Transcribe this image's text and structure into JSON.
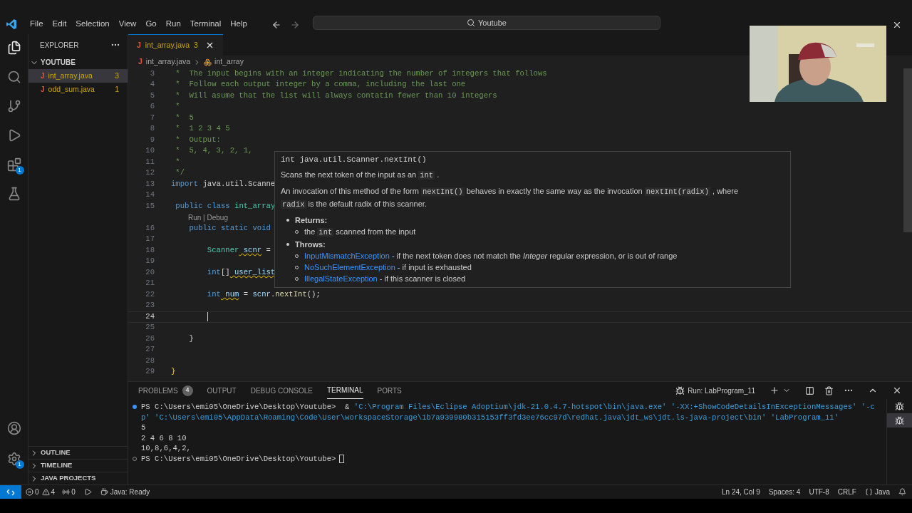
{
  "menu": [
    "File",
    "Edit",
    "Selection",
    "View",
    "Go",
    "Run",
    "Terminal",
    "Help"
  ],
  "command_center": {
    "value": "Youtube"
  },
  "activity_bar": [
    {
      "kind": "files",
      "selected": true
    },
    {
      "kind": "search",
      "selected": false
    },
    {
      "kind": "source-control",
      "selected": false
    },
    {
      "kind": "run",
      "selected": false
    },
    {
      "kind": "extensions",
      "selected": false,
      "badge": "1"
    },
    {
      "kind": "testing",
      "selected": false
    }
  ],
  "activity_bottom": [
    {
      "kind": "account"
    },
    {
      "kind": "settings",
      "badge": "1"
    }
  ],
  "sidebar": {
    "title": "EXPLORER",
    "folder": "YOUTUBE",
    "expanded": true,
    "files": [
      {
        "icon": "J",
        "name": "int_array.java",
        "count": "3",
        "selected": true
      },
      {
        "icon": "J",
        "name": "odd_sum.java",
        "count": "1",
        "selected": false
      }
    ],
    "sections": [
      {
        "label": "OUTLINE",
        "expanded": false
      },
      {
        "label": "TIMELINE",
        "expanded": false
      },
      {
        "label": "JAVA PROJECTS",
        "expanded": false
      }
    ]
  },
  "tabs": [
    {
      "icon": "J",
      "label": "int_array.java",
      "count": "3",
      "selected": true
    }
  ],
  "breadcrumb": {
    "icon": "J",
    "file": "int_array.java",
    "symbol": "int_array"
  },
  "lines": [
    {
      "number": "3",
      "kind": "code",
      "current": false,
      "segments": [
        {
          "text": " *  The input begins with an integer indicating the number of integers that follows",
          "kind": "comment"
        }
      ]
    },
    {
      "number": "4",
      "kind": "code",
      "current": false,
      "segments": [
        {
          "text": " *  Follow each output integer by a comma, including the last one",
          "kind": "comment"
        }
      ]
    },
    {
      "number": "5",
      "kind": "code",
      "current": false,
      "segments": [
        {
          "text": " *  Will asume that the list will always contatin fewer than 10 integers",
          "kind": "comment"
        }
      ]
    },
    {
      "number": "6",
      "kind": "code",
      "current": false,
      "segments": [
        {
          "text": " *",
          "kind": "comment"
        }
      ]
    },
    {
      "number": "7",
      "kind": "code",
      "current": false,
      "segments": [
        {
          "text": " *  5",
          "kind": "comment"
        }
      ]
    },
    {
      "number": "8",
      "kind": "code",
      "current": false,
      "segments": [
        {
          "text": " *  1 2 3 4 5",
          "kind": "comment"
        }
      ]
    },
    {
      "number": "9",
      "kind": "code",
      "current": false,
      "segments": [
        {
          "text": " *  Output:",
          "kind": "comment"
        }
      ]
    },
    {
      "number": "10",
      "kind": "code",
      "current": false,
      "segments": [
        {
          "text": " *  5, 4, 3, 2, 1,",
          "kind": "comment"
        }
      ]
    },
    {
      "number": "11",
      "kind": "code",
      "current": false,
      "segments": [
        {
          "text": " *",
          "kind": "comment"
        }
      ]
    },
    {
      "number": "12",
      "kind": "code",
      "current": false,
      "segments": [
        {
          "text": " */",
          "kind": "comment"
        }
      ]
    },
    {
      "number": "13",
      "kind": "code",
      "current": false,
      "segments": [
        {
          "text": "import",
          "kind": "keyword"
        },
        {
          "text": " java.util.Scanne",
          "kind": "plain"
        }
      ]
    },
    {
      "number": "14",
      "kind": "code",
      "current": false
    },
    {
      "number": "15",
      "kind": "code",
      "current": false,
      "segments": [
        {
          "text": " public",
          "kind": "keyword"
        },
        {
          "text": " class",
          "kind": "keyword"
        },
        {
          "text": " int_array",
          "kind": "type"
        }
      ]
    },
    {
      "kind": "codelens",
      "text": "Run | Debug"
    },
    {
      "number": "16",
      "kind": "code",
      "current": false,
      "segments": [
        {
          "text": "    public",
          "kind": "keyword"
        },
        {
          "text": " static",
          "kind": "keyword"
        },
        {
          "text": " void",
          "kind": "keyword"
        }
      ]
    },
    {
      "number": "17",
      "kind": "code",
      "current": false
    },
    {
      "number": "18",
      "kind": "code",
      "current": false,
      "segments": [
        {
          "text": "        Scanner",
          "kind": "type"
        },
        {
          "text": " scnr",
          "kind": "warn"
        },
        {
          "text": " =",
          "kind": "plain"
        }
      ]
    },
    {
      "number": "19",
      "kind": "code",
      "current": false
    },
    {
      "number": "20",
      "kind": "code",
      "current": false,
      "segments": [
        {
          "text": "        int",
          "kind": "keyword"
        },
        {
          "text": "[]",
          "kind": "plain"
        },
        {
          "text": " user_list",
          "kind": "warn"
        }
      ]
    },
    {
      "number": "21",
      "kind": "code",
      "current": false
    },
    {
      "number": "22",
      "kind": "code",
      "current": false,
      "segments": [
        {
          "text": "        int",
          "kind": "keyword"
        },
        {
          "text": " num",
          "kind": "warn"
        },
        {
          "text": " = ",
          "kind": "plain"
        },
        {
          "text": "scnr",
          "kind": "variable"
        },
        {
          "text": ".",
          "kind": "plain"
        },
        {
          "text": "nextInt",
          "kind": "function"
        },
        {
          "text": "();",
          "kind": "plain"
        }
      ]
    },
    {
      "number": "23",
      "kind": "code",
      "current": false
    },
    {
      "number": "24",
      "kind": "code",
      "current": true
    },
    {
      "number": "25",
      "kind": "code",
      "current": false
    },
    {
      "number": "26",
      "kind": "code",
      "current": false,
      "segments": [
        {
          "text": "    }",
          "kind": "plain"
        }
      ]
    },
    {
      "number": "27",
      "kind": "code",
      "current": false
    },
    {
      "number": "28",
      "kind": "code",
      "current": false
    },
    {
      "number": "29",
      "kind": "code",
      "current": false,
      "segments": [
        {
          "text": "}",
          "kind": "bracket"
        }
      ]
    }
  ],
  "hover": {
    "signature": "int java.util.Scanner.nextInt()",
    "paragraphs": [
      [
        {
          "text": "Scans the next token of the input as an ",
          "kind": "text"
        },
        {
          "text": "int",
          "kind": "code"
        },
        {
          "text": " .",
          "kind": "text"
        }
      ],
      [
        {
          "text": "An invocation of this method of the form ",
          "kind": "text"
        },
        {
          "text": "nextInt()",
          "kind": "code"
        },
        {
          "text": " behaves in exactly the same way as the invocation ",
          "kind": "text"
        },
        {
          "text": "nextInt(radix)",
          "kind": "code"
        },
        {
          "text": " , where ",
          "kind": "text"
        },
        {
          "text": "radix",
          "kind": "code"
        },
        {
          "text": " is the default radix of this scanner.",
          "kind": "text"
        }
      ]
    ],
    "returns_label": "Returns:",
    "returns": [
      {
        "text": "the ",
        "kind": "text"
      },
      {
        "text": "int",
        "kind": "code"
      },
      {
        "text": " scanned from the input",
        "kind": "text"
      }
    ],
    "throws_label": "Throws:",
    "throws": [
      {
        "exception": "InputMismatchException",
        "description": " - if the next token does not match the *Integer* regular expression, or is out of range"
      },
      {
        "exception": "NoSuchElementException",
        "description": " - if input is exhausted"
      },
      {
        "exception": "IllegalStateException",
        "description": " - if this scanner is closed"
      }
    ]
  },
  "panel": {
    "tabs": [
      {
        "label": "PROBLEMS",
        "badge": "4",
        "selected": false
      },
      {
        "label": "OUTPUT",
        "selected": false
      },
      {
        "label": "DEBUG CONSOLE",
        "selected": false
      },
      {
        "label": "TERMINAL",
        "selected": true
      },
      {
        "label": "PORTS",
        "selected": false
      }
    ],
    "run_label": "Run: LabProgram_11",
    "terminal": [
      {
        "kind": "command",
        "segments": [
          {
            "text": "PS C:\\Users\\emi05\\OneDrive\\Desktop\\Youtube>  ",
            "kind": "prompt"
          },
          {
            "text": "& ",
            "kind": "plain"
          },
          {
            "text": "'C:\\Program Files\\Eclipse Adoptium\\jdk-21.0.4.7-hotspot\\bin\\java.exe' '-XX:+ShowCodeDetailsInExceptionMessages' '-cp' 'C:\\Users\\emi05\\AppData\\Roaming\\Code\\User\\workspaceStorage\\1b7a939980b315153ff3fd3ee76cc97d\\redhat.java\\jdt_ws\\jdt.ls-java-project\\bin' 'LabProgram_11'",
            "kind": "string"
          }
        ]
      },
      {
        "kind": "output",
        "segments": [
          {
            "text": "5",
            "kind": "plain"
          }
        ]
      },
      {
        "kind": "output",
        "segments": [
          {
            "text": "2 4 6 8 10",
            "kind": "plain"
          }
        ]
      },
      {
        "kind": "output",
        "segments": [
          {
            "text": "10,8,6,4,2,",
            "kind": "plain"
          }
        ]
      },
      {
        "kind": "prompt",
        "cursor": true,
        "segments": [
          {
            "text": "PS C:\\Users\\emi05\\OneDrive\\Desktop\\Youtube>",
            "kind": "prompt"
          }
        ]
      }
    ],
    "instances": [
      {
        "selected": false
      },
      {
        "selected": true
      }
    ]
  },
  "status": {
    "errors": "0",
    "warnings": "4",
    "ports": "0",
    "java": "Java: Ready",
    "position": "Ln 24, Col 9",
    "spaces": "Spaces: 4",
    "encoding": "UTF-8",
    "eol": "CRLF",
    "language": "Java"
  }
}
